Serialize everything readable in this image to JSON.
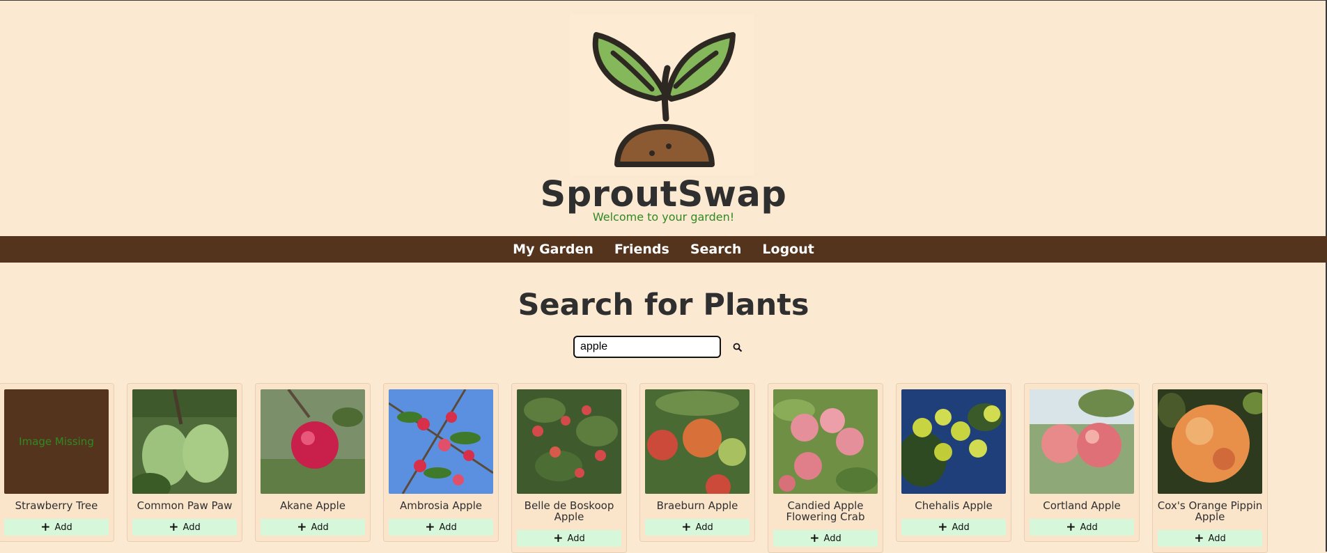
{
  "app": {
    "title": "SproutSwap",
    "tagline": "Welcome to your garden!"
  },
  "nav": {
    "items": [
      {
        "label": "My Garden"
      },
      {
        "label": "Friends"
      },
      {
        "label": "Search"
      },
      {
        "label": "Logout"
      }
    ]
  },
  "search": {
    "heading": "Search for Plants",
    "value": "apple",
    "button_icon": "search-icon"
  },
  "results": [
    {
      "name": "Strawberry Tree",
      "image": "missing",
      "missing_text": "Image Missing",
      "add_label": "Add"
    },
    {
      "name": "Common Paw Paw",
      "image": "pawpaw",
      "add_label": "Add"
    },
    {
      "name": "Akane Apple",
      "image": "red-apple",
      "add_label": "Add"
    },
    {
      "name": "Ambrosia Apple",
      "image": "apples-sky",
      "add_label": "Add"
    },
    {
      "name": "Belle de Boskoop Apple",
      "image": "apple-tree",
      "add_label": "Add"
    },
    {
      "name": "Braeburn Apple",
      "image": "apple-cluster",
      "add_label": "Add"
    },
    {
      "name": "Candied Apple Flowering Crab",
      "image": "pink-apples",
      "add_label": "Add"
    },
    {
      "name": "Chehalis Apple",
      "image": "green-apples",
      "add_label": "Add"
    },
    {
      "name": "Cortland Apple",
      "image": "two-apples",
      "add_label": "Add"
    },
    {
      "name": "Cox's Orange Pippin Apple",
      "image": "orange-apple",
      "add_label": "Add"
    }
  ],
  "colors": {
    "background": "#fbe9d1",
    "nav": "#55341e",
    "accent_green": "#2f8a22",
    "add_button": "#d6f7d9"
  }
}
